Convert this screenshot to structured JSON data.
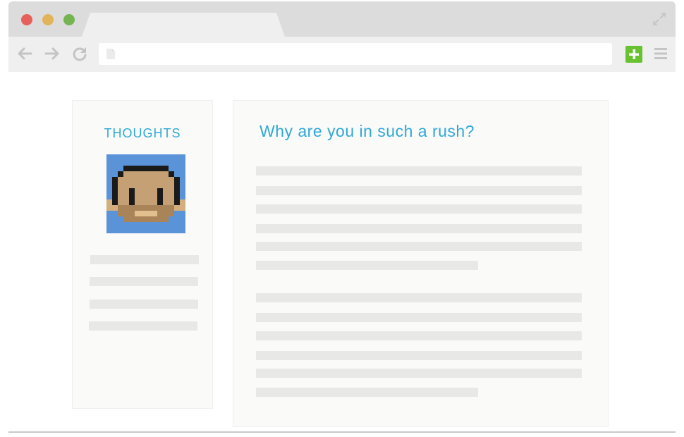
{
  "colors": {
    "accent": "#2fa8d6",
    "tab_bar": "#dcdcdc",
    "toolbar": "#efefef",
    "placeholder_bar": "#e8e8e6",
    "add_button": "#68c230",
    "avatar_background": "#5b93d9"
  },
  "browser": {
    "window_controls": [
      "close",
      "minimize",
      "maximize"
    ],
    "icons": {
      "back": "back-arrow-icon",
      "forward": "forward-arrow-icon",
      "reload": "reload-icon",
      "page": "page-icon",
      "add": "plus-icon",
      "menu": "hamburger-menu-icon",
      "expand": "expand-icon"
    },
    "address_value": ""
  },
  "sidebar": {
    "title": "THOUGHTS",
    "avatar": "pixel-face-avatar"
  },
  "article": {
    "title": "Why are you in such a rush?"
  }
}
